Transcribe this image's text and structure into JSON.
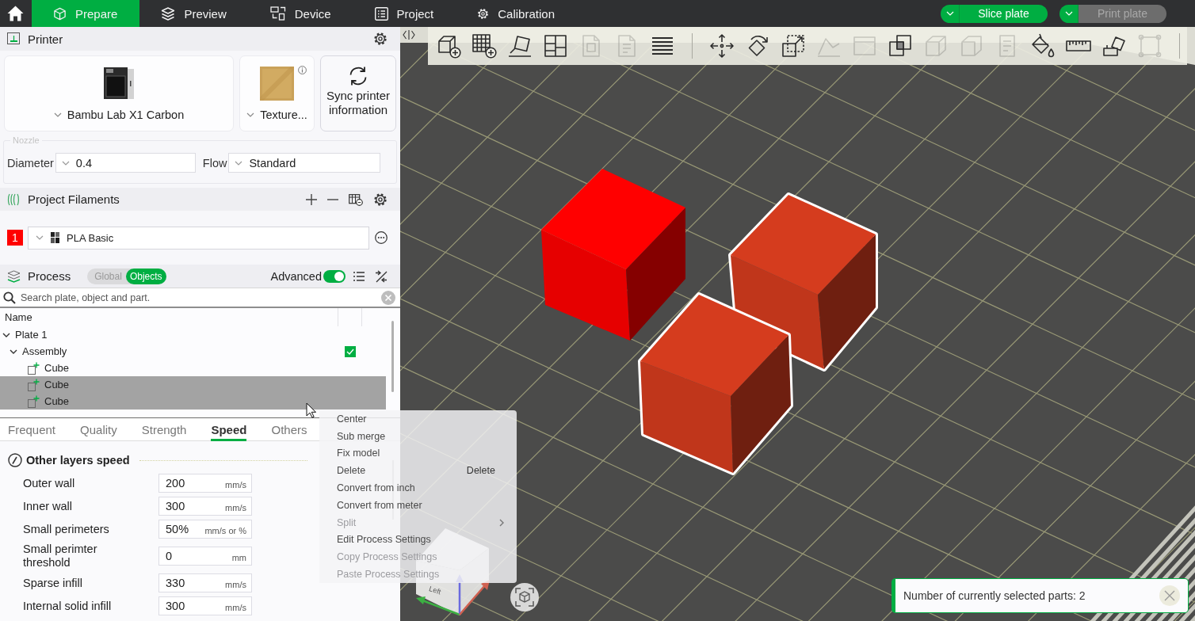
{
  "top_bar": {
    "tabs": [
      {
        "label": "Prepare",
        "selected": true
      },
      {
        "label": "Preview",
        "selected": false
      },
      {
        "label": "Device",
        "selected": false
      },
      {
        "label": "Project",
        "selected": false
      },
      {
        "label": "Calibration",
        "selected": false
      }
    ],
    "actions": [
      {
        "label": "Slice plate",
        "disabled": false
      },
      {
        "label": "Print plate",
        "disabled": true
      }
    ]
  },
  "printer": {
    "title": "Printer",
    "printer_name": "Bambu Lab X1 Carbon",
    "plate_type": "Texture...",
    "sync_button": "Sync printer information",
    "nozzle": {
      "legend": "Nozzle",
      "diameter_label": "Diameter",
      "diameter": "0.4",
      "flow_label": "Flow",
      "flow": "Standard"
    }
  },
  "filaments": {
    "title": "Project Filaments",
    "items": [
      {
        "number": "1",
        "color": "#ff0000",
        "name": "PLA Basic"
      }
    ]
  },
  "process": {
    "title": "Process",
    "scopes": [
      {
        "label": "Global",
        "selected": false
      },
      {
        "label": "Objects",
        "selected": true
      }
    ],
    "advanced_label": "Advanced",
    "advanced_on": true,
    "search": {
      "placeholder": "Search plate, object and part."
    },
    "tree": {
      "column": "Name",
      "items": [
        {
          "label": "Plate 1",
          "expanded": true,
          "selected": false,
          "checked": false,
          "children": [
            {
              "label": "Assembly",
              "expanded": true,
              "selected": false,
              "checked": true,
              "children": [
                {
                  "label": "Cube",
                  "selected": false,
                  "checked": false
                },
                {
                  "label": "Cube",
                  "selected": true,
                  "checked": false
                },
                {
                  "label": "Cube",
                  "selected": true,
                  "checked": false
                }
              ]
            }
          ]
        }
      ]
    }
  },
  "settings": {
    "tabs": [
      {
        "label": "Frequent",
        "selected": false
      },
      {
        "label": "Quality",
        "selected": false
      },
      {
        "label": "Strength",
        "selected": false
      },
      {
        "label": "Speed",
        "selected": true
      },
      {
        "label": "Others",
        "selected": false
      }
    ],
    "section": "Other layers speed",
    "rows": [
      {
        "label": "Outer wall",
        "value": "200",
        "unit": "mm/s"
      },
      {
        "label": "Inner wall",
        "value": "300",
        "unit": "mm/s"
      },
      {
        "label": "Small perimeters",
        "value": "50%",
        "unit": "mm/s or %"
      },
      {
        "label": "Small perimter threshold",
        "value": "0",
        "unit": "mm"
      },
      {
        "label": "Sparse infill",
        "value": "330",
        "unit": "mm/s"
      },
      {
        "label": "Internal solid infill",
        "value": "300",
        "unit": "mm/s"
      }
    ]
  },
  "viewport": {
    "toolbar": [
      {
        "tools": [
          {
            "disabled": false
          },
          {
            "disabled": false
          },
          {
            "disabled": false
          },
          {
            "disabled": false
          },
          {
            "disabled": true
          },
          {
            "disabled": true
          },
          {
            "disabled": false
          }
        ]
      },
      {
        "tools": [
          {
            "disabled": false
          },
          {
            "disabled": false
          },
          {
            "disabled": false
          },
          {
            "disabled": true
          },
          {
            "disabled": true
          },
          {
            "disabled": false
          },
          {
            "disabled": true
          },
          {
            "disabled": true
          },
          {
            "disabled": true
          },
          {
            "disabled": false
          },
          {
            "disabled": false
          },
          {
            "disabled": false
          },
          {
            "disabled": true
          }
        ]
      }
    ],
    "view_cube": {
      "left_label": "Left"
    },
    "notification": {
      "message": "Number of currently selected parts: 2"
    }
  },
  "context_menu": {
    "items": [
      {
        "label": "Center",
        "disabled": false,
        "submenu": false
      },
      {
        "label": "Sub merge",
        "disabled": false,
        "submenu": false
      },
      {
        "label": "Fix model",
        "disabled": false,
        "submenu": false
      },
      {
        "label": "Delete",
        "shortcut": "Delete",
        "disabled": false,
        "submenu": false
      },
      {
        "label": "Convert from inch",
        "disabled": false,
        "submenu": false
      },
      {
        "label": "Convert from meter",
        "disabled": false,
        "submenu": false
      },
      {
        "label": "Split",
        "disabled": true,
        "submenu": true
      },
      {
        "label": "Edit Process Settings",
        "disabled": false,
        "submenu": false
      },
      {
        "label": "Copy Process Settings",
        "disabled": true,
        "submenu": false
      },
      {
        "label": "Paste Process Settings",
        "disabled": true,
        "submenu": false
      }
    ]
  }
}
